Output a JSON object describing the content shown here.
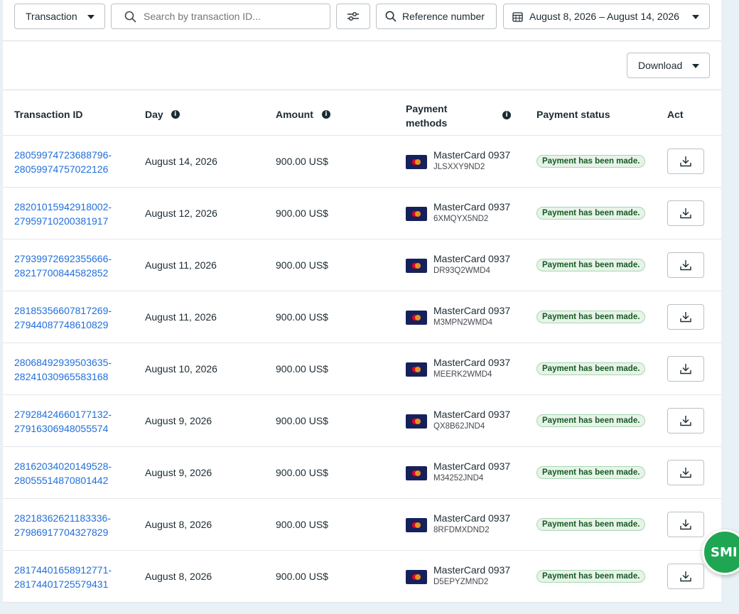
{
  "filters": {
    "type_label": "Transaction",
    "search_placeholder": "Search by transaction ID...",
    "reference_label": "Reference number",
    "date_range": "August 8, 2026 – August 14, 2026"
  },
  "toolbar": {
    "download_label": "Download"
  },
  "table": {
    "headers": {
      "transaction_id": "Transaction ID",
      "day": "Day",
      "amount": "Amount",
      "payment_methods_line1": "Payment",
      "payment_methods_line2": "methods",
      "payment_status": "Payment status",
      "act": "Act"
    },
    "rows": [
      {
        "id1": "28059974723688796-",
        "id2": "28059974757022126",
        "day": "August 14, 2026",
        "amount": "900.00 US$",
        "method": "MasterCard 0937",
        "code": "JLSXXY9ND2",
        "status": "Payment has been made."
      },
      {
        "id1": "28201015942918002-",
        "id2": "27959710200381917",
        "day": "August 12, 2026",
        "amount": "900.00 US$",
        "method": "MasterCard 0937",
        "code": "6XMQYX5ND2",
        "status": "Payment has been made."
      },
      {
        "id1": "27939972692355666-",
        "id2": "28217700844582852",
        "day": "August 11, 2026",
        "amount": "900.00 US$",
        "method": "MasterCard 0937",
        "code": "DR93Q2WMD4",
        "status": "Payment has been made."
      },
      {
        "id1": "28185356607817269-",
        "id2": "27944087748610829",
        "day": "August 11, 2026",
        "amount": "900.00 US$",
        "method": "MasterCard 0937",
        "code": "M3MPN2WMD4",
        "status": "Payment has been made."
      },
      {
        "id1": "28068492939503635-",
        "id2": "28241030965583168",
        "day": "August 10, 2026",
        "amount": "900.00 US$",
        "method": "MasterCard 0937",
        "code": "MEERK2WMD4",
        "status": "Payment has been made."
      },
      {
        "id1": "27928424660177132-",
        "id2": "27916306948055574",
        "day": "August 9, 2026",
        "amount": "900.00 US$",
        "method": "MasterCard 0937",
        "code": "QX8B62JND4",
        "status": "Payment has been made."
      },
      {
        "id1": "28162034020149528-",
        "id2": "28055514870801442",
        "day": "August 9, 2026",
        "amount": "900.00 US$",
        "method": "MasterCard 0937",
        "code": "M34252JND4",
        "status": "Payment has been made."
      },
      {
        "id1": "28218362621183336-",
        "id2": "27986917704327829",
        "day": "August 8, 2026",
        "amount": "900.00 US$",
        "method": "MasterCard 0937",
        "code": "8RFDMXDND2",
        "status": "Payment has been made."
      },
      {
        "id1": "28174401658912771-",
        "id2": "28174401725579431",
        "day": "August 8, 2026",
        "amount": "900.00 US$",
        "method": "MasterCard 0937",
        "code": "D5EPYZMND2",
        "status": "Payment has been made."
      }
    ]
  },
  "chat_widget": {
    "label": "SMI"
  }
}
